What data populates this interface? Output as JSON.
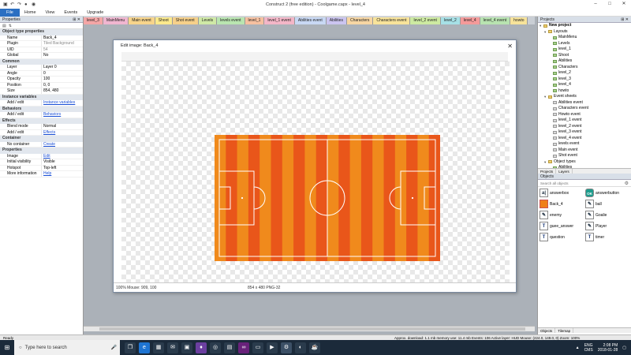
{
  "window": {
    "title": "Construct 2  (free edition) - Coolgame.capx - level_4"
  },
  "menu": [
    "File",
    "Home",
    "View",
    "Events",
    "Upgrade"
  ],
  "tabs": [
    {
      "label": "level_3",
      "color": "#f4a6a6"
    },
    {
      "label": "MainMenu",
      "color": "#f0b6d0"
    },
    {
      "label": "Main event",
      "color": "#f7d48b"
    },
    {
      "label": "Shoot",
      "color": "#fbe98c"
    },
    {
      "label": "Shot event",
      "color": "#f6d08a"
    },
    {
      "label": "Levels",
      "color": "#cfe9a6"
    },
    {
      "label": "levels event",
      "color": "#b9e5b0"
    },
    {
      "label": "level_1",
      "color": "#f6c0a0"
    },
    {
      "label": "level_1 event",
      "color": "#f3b6c7"
    },
    {
      "label": "Abilities event",
      "color": "#c8d8f4"
    },
    {
      "label": "Abilities",
      "color": "#cbc4f0"
    },
    {
      "label": "Characters",
      "color": "#f7d6a3"
    },
    {
      "label": "Characters event",
      "color": "#f8e39a"
    },
    {
      "label": "level_2 event",
      "color": "#cdeaa1"
    },
    {
      "label": "level_2",
      "color": "#a6e0e6"
    },
    {
      "label": "level_4",
      "color": "#f49a9a"
    },
    {
      "label": "level_4 event",
      "color": "#b8e3b0"
    },
    {
      "label": "howto",
      "color": "#f7e39a"
    }
  ],
  "properties": {
    "header": "Properties",
    "sections": [
      {
        "title": "Object type properties",
        "rows": [
          {
            "k": "Name",
            "v": "Back_4",
            "style": ""
          },
          {
            "k": "Plugin",
            "v": "Tiled Background",
            "style": "gray"
          },
          {
            "k": "UID",
            "v": "54",
            "style": "gray"
          },
          {
            "k": "Global",
            "v": "No",
            "style": ""
          }
        ]
      },
      {
        "title": "Common",
        "rows": [
          {
            "k": "Layer",
            "v": "Layer 0",
            "style": ""
          },
          {
            "k": "Angle",
            "v": "0",
            "style": ""
          },
          {
            "k": "Opacity",
            "v": "100",
            "style": ""
          },
          {
            "k": "Position",
            "v": "0, 0",
            "style": ""
          },
          {
            "k": "Size",
            "v": "854, 480",
            "style": ""
          }
        ]
      },
      {
        "title": "Instance variables",
        "rows": [
          {
            "k": "Add / edit",
            "v": "Instance variables",
            "style": "link"
          }
        ]
      },
      {
        "title": "Behaviors",
        "rows": [
          {
            "k": "Add / edit",
            "v": "Behaviors",
            "style": "link"
          }
        ]
      },
      {
        "title": "Effects",
        "rows": [
          {
            "k": "Blend mode",
            "v": "Normal",
            "style": ""
          },
          {
            "k": "Add / edit",
            "v": "Effects",
            "style": "link"
          }
        ]
      },
      {
        "title": "Container",
        "rows": [
          {
            "k": "No container",
            "v": "Create",
            "style": "link"
          }
        ]
      },
      {
        "title": "Properties",
        "rows": [
          {
            "k": "Image",
            "v": "Edit",
            "style": "link"
          },
          {
            "k": "Initial visibility",
            "v": "Visible",
            "style": ""
          },
          {
            "k": "Hotspot",
            "v": "Top-left",
            "style": ""
          },
          {
            "k": "More information",
            "v": "Help",
            "style": "link"
          }
        ]
      }
    ]
  },
  "dialog": {
    "title": "Edit image: Back_4",
    "status_left": "100%  Mouse: 909, 100",
    "status_mid": "854 x 480  PNG-32",
    "pitch": {
      "stripe_colors": [
        "#f08a1c",
        "#e9561a"
      ],
      "stripes": 20,
      "line_color": "#ffffff"
    }
  },
  "projects": {
    "header": "Projects",
    "items": [
      {
        "label": "New project",
        "type": "root",
        "depth": 0,
        "bold": true
      },
      {
        "label": "Layouts",
        "type": "folder",
        "depth": 1
      },
      {
        "label": "MainMenu",
        "type": "page",
        "depth": 2
      },
      {
        "label": "Levels",
        "type": "page",
        "depth": 2
      },
      {
        "label": "level_1",
        "type": "page",
        "depth": 2
      },
      {
        "label": "Shoot",
        "type": "page",
        "depth": 2
      },
      {
        "label": "Abilities",
        "type": "page",
        "depth": 2
      },
      {
        "label": "Characters",
        "type": "page",
        "depth": 2
      },
      {
        "label": "level_2",
        "type": "page",
        "depth": 2
      },
      {
        "label": "level_3",
        "type": "page",
        "depth": 2
      },
      {
        "label": "level_4",
        "type": "page",
        "depth": 2
      },
      {
        "label": "howto",
        "type": "page",
        "depth": 2
      },
      {
        "label": "Event sheets",
        "type": "folder",
        "depth": 1
      },
      {
        "label": "Abilities event",
        "type": "ev",
        "depth": 2
      },
      {
        "label": "Characters event",
        "type": "ev",
        "depth": 2
      },
      {
        "label": "Howto event",
        "type": "ev",
        "depth": 2
      },
      {
        "label": "level_1 event",
        "type": "ev",
        "depth": 2
      },
      {
        "label": "level_2 event",
        "type": "ev",
        "depth": 2
      },
      {
        "label": "level_3 event",
        "type": "ev",
        "depth": 2
      },
      {
        "label": "level_4 event",
        "type": "ev",
        "depth": 2
      },
      {
        "label": "levels event",
        "type": "ev",
        "depth": 2
      },
      {
        "label": "Main event",
        "type": "ev",
        "depth": 2
      },
      {
        "label": "Shot event",
        "type": "ev",
        "depth": 2
      },
      {
        "label": "Object types",
        "type": "folder",
        "depth": 1
      },
      {
        "label": "Abilities",
        "type": "page",
        "depth": 2
      }
    ],
    "subtabs": [
      "Projects",
      "Layers"
    ]
  },
  "objects": {
    "header": "Objects",
    "filter_placeholder": "Search all objects",
    "items": [
      {
        "label": "answerbox",
        "icon": "textbox"
      },
      {
        "label": "answerbutton",
        "icon": "button"
      },
      {
        "label": "Back_4",
        "icon": "tiled"
      },
      {
        "label": "ball",
        "icon": "sprite"
      },
      {
        "label": "enemy",
        "icon": "sprite"
      },
      {
        "label": "Goalie",
        "icon": "sprite"
      },
      {
        "label": "guee_answer",
        "icon": "text"
      },
      {
        "label": "Player",
        "icon": "sprite"
      },
      {
        "label": "question",
        "icon": "text"
      },
      {
        "label": "timer",
        "icon": "text"
      }
    ],
    "subtabs": [
      "Objects",
      "Tilemap"
    ]
  },
  "statusbar": {
    "left": "Ready",
    "right": "Approx. download: 1.1 mb   memory use: 11.4 mb   Events: 106        Active layer: HUD          Mouse: (224.0, 149.0, 0)          Zoom: 100%"
  },
  "taskbar": {
    "search_placeholder": "Type here to search",
    "lang": "ENG",
    "sub": "CMS",
    "time": "2:08 PM",
    "date": "2018-01-28"
  }
}
